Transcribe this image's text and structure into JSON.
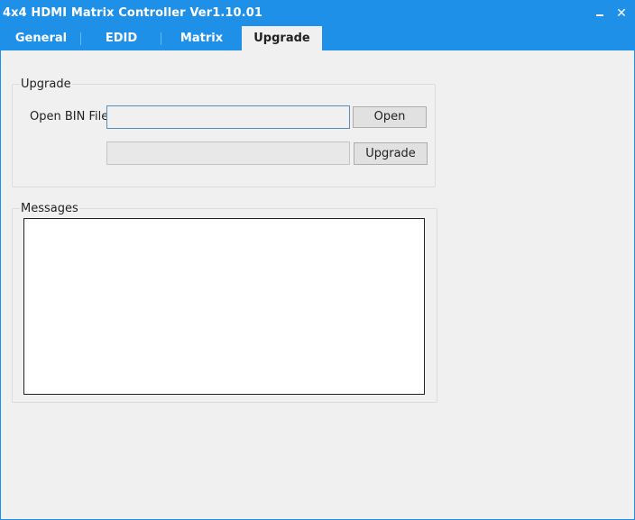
{
  "window": {
    "title": "4x4 HDMI Matrix Controller Ver1.10.01",
    "minimize_glyph": "–",
    "close_glyph": "✕"
  },
  "tabs": [
    {
      "label": "General"
    },
    {
      "label": "EDID"
    },
    {
      "label": "Matrix"
    },
    {
      "label": "Upgrade",
      "active": true
    }
  ],
  "upgrade_group": {
    "title": "Upgrade",
    "open_bin_label": "Open BIN File",
    "bin_path_value": "",
    "progress_value": "",
    "open_button": "Open",
    "upgrade_button": "Upgrade"
  },
  "messages_group": {
    "title": "Messages",
    "content": ""
  },
  "colors": {
    "titlebar": "#1e90e8",
    "background": "#f0f0f0"
  }
}
